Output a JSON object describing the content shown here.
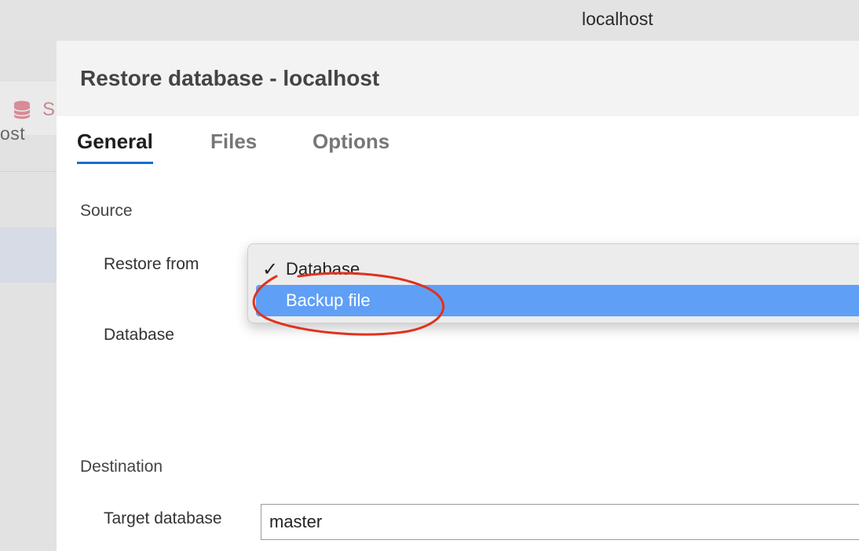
{
  "window": {
    "title": "localhost"
  },
  "background": {
    "tab_text": "S",
    "server_label": "ost"
  },
  "dialog": {
    "title": "Restore database - localhost",
    "tabs": [
      {
        "label": "General",
        "active": true
      },
      {
        "label": "Files",
        "active": false
      },
      {
        "label": "Options",
        "active": false
      }
    ],
    "source": {
      "section_label": "Source",
      "restore_from_label": "Restore from",
      "restore_from_options": [
        {
          "label": "Database",
          "checked": true,
          "highlighted": false
        },
        {
          "label": "Backup file",
          "checked": false,
          "highlighted": true
        }
      ],
      "database_label": "Database",
      "database_value": ""
    },
    "destination": {
      "section_label": "Destination",
      "target_label": "Target database",
      "target_value": "master"
    }
  },
  "colors": {
    "tab_underline": "#1a6fc9",
    "menu_highlight": "#5f9ff5",
    "annotation": "#e0321e"
  }
}
